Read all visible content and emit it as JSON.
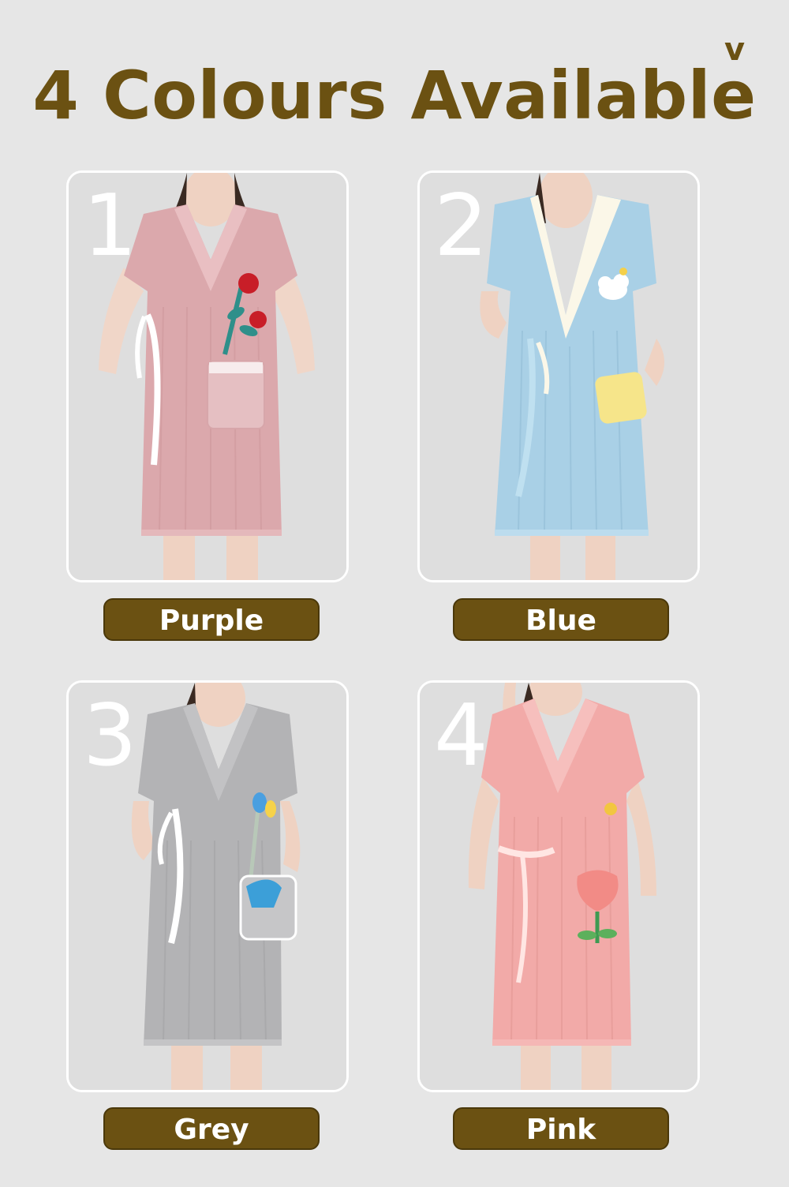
{
  "header": {
    "title": "4 Colours Available",
    "corner_mark": "v"
  },
  "colours": [
    {
      "number": "1",
      "label": "Purple",
      "robe_color": "#dba8ac",
      "accent": "#ffffff",
      "pocket_color": "#e5bfc2",
      "embroidery": "rose-icon"
    },
    {
      "number": "2",
      "label": "Blue",
      "robe_color": "#a9d0e6",
      "accent": "#fbf7e8",
      "pocket_color": "#f6e58a",
      "embroidery": "cloud-icon"
    },
    {
      "number": "3",
      "label": "Grey",
      "robe_color": "#b3b3b5",
      "accent": "#ffffff",
      "pocket_color": "#3c9fd8",
      "embroidery": "tulip-icon"
    },
    {
      "number": "4",
      "label": "Pink",
      "robe_color": "#f2aaa8",
      "accent": "#ffe6e3",
      "pocket_color": "#f28b86",
      "embroidery": "flower-pocket-icon"
    }
  ],
  "colors": {
    "brand_brown": "#6b5112",
    "background": "#e6e6e6",
    "card_border": "#ffffff"
  }
}
